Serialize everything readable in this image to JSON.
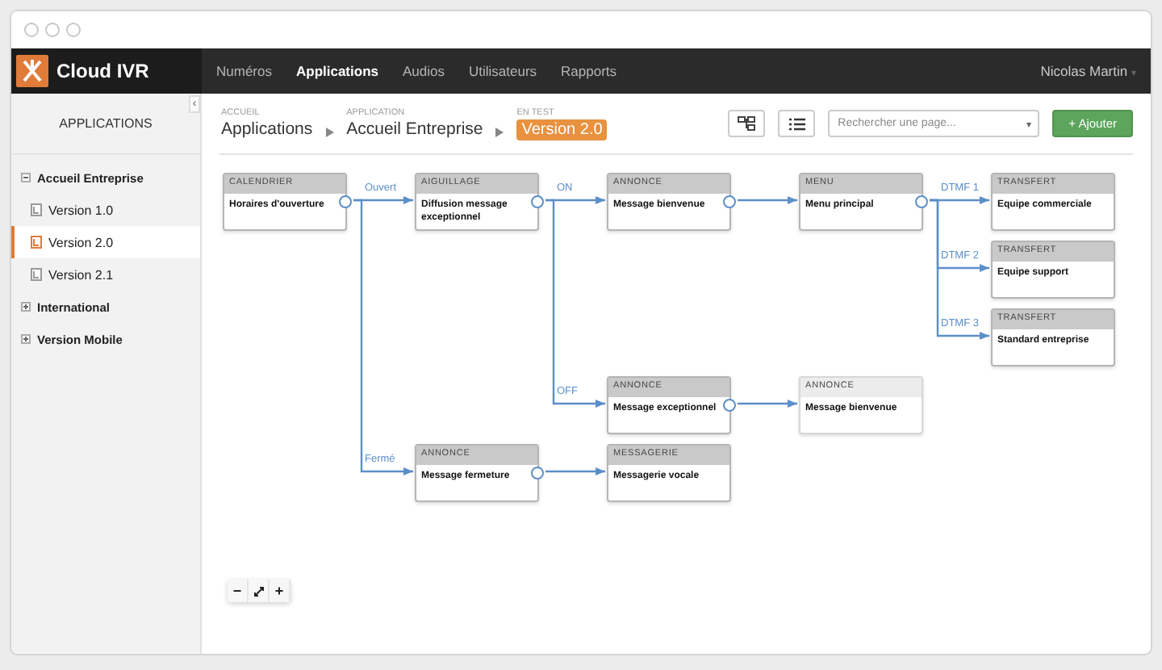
{
  "brand": {
    "name": "Cloud IVR"
  },
  "nav": [
    {
      "label": "Numéros",
      "selected": false
    },
    {
      "label": "Applications",
      "selected": true
    },
    {
      "label": "Audios",
      "selected": false
    },
    {
      "label": "Utilisateurs",
      "selected": false
    },
    {
      "label": "Rapports",
      "selected": false
    }
  ],
  "user": {
    "name": "Nicolas Martin",
    "caret": "▾"
  },
  "sidebar": {
    "title": "APPLICATIONS",
    "collapse": "‹",
    "tree": [
      {
        "label": "Accueil Entreprise",
        "expanded": true,
        "children": [
          {
            "label": "Version 1.0",
            "selected": false
          },
          {
            "label": "Version 2.0",
            "selected": true
          },
          {
            "label": "Version 2.1",
            "selected": false
          }
        ]
      },
      {
        "label": "International",
        "expanded": false
      },
      {
        "label": "Version Mobile",
        "expanded": false
      }
    ]
  },
  "breadcrumbs": [
    {
      "caption": "ACCUEIL",
      "label": "Applications",
      "kind": "link"
    },
    {
      "caption": "APPLICATION",
      "label": "Accueil Entreprise",
      "kind": "link"
    },
    {
      "caption": "EN TEST",
      "label": "Version 2.0",
      "kind": "badge"
    }
  ],
  "search": {
    "placeholder": "Rechercher une page...",
    "caret": "▾"
  },
  "add_button": {
    "label": "+ Ajouter"
  },
  "flow": {
    "type": "CALENDRIER",
    "label": "Horaires d'ouverture",
    "active": true,
    "children": [
      {
        "branch": "Ouvert",
        "type": "AIGUILLAGE",
        "label": "Diffusion message exceptionnel",
        "active": true,
        "children": [
          {
            "branch": "ON",
            "type": "ANNONCE",
            "label": "Message bienvenue",
            "active": true,
            "children": [
              {
                "type": "MENU",
                "label": "Menu principal",
                "active": true,
                "children": [
                  {
                    "branch": "DTMF 1",
                    "type": "TRANSFERT",
                    "label": "Equipe commerciale",
                    "active": true
                  },
                  {
                    "branch": "DTMF 2",
                    "type": "TRANSFERT",
                    "label": "Equipe support",
                    "active": true
                  },
                  {
                    "branch": "DTMF 3",
                    "type": "TRANSFERT",
                    "label": "Standard entreprise",
                    "active": true
                  }
                ]
              }
            ]
          },
          {
            "branch": "OFF",
            "type": "ANNONCE",
            "label": "Message exceptionnel",
            "active": true,
            "children": [
              {
                "type": "ANNONCE",
                "label": "Message bienvenue",
                "active": false
              }
            ]
          }
        ]
      },
      {
        "branch": "Fermé",
        "type": "ANNONCE",
        "label": "Message fermeture",
        "active": true,
        "children": [
          {
            "type": "MESSAGERIE",
            "label": "Messagerie vocale",
            "active": true
          }
        ]
      }
    ]
  },
  "zoom_controls": {
    "minus": "−",
    "plus": "+"
  }
}
